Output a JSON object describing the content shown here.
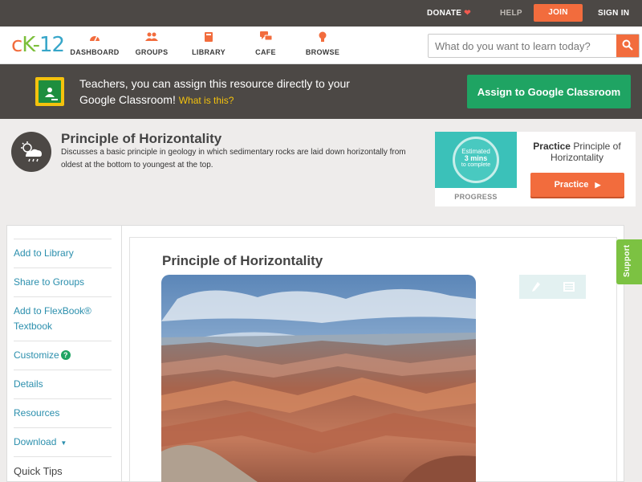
{
  "utility_bar": {
    "donate": "DONATE",
    "help": "HELP",
    "join": "JOIN",
    "sign_in": "SIGN IN"
  },
  "logo": {
    "c": "c",
    "k": "K",
    "dash": "-",
    "n": "12"
  },
  "nav": {
    "items": [
      {
        "label": "DASHBOARD",
        "icon": "dashboard-gauge-icon"
      },
      {
        "label": "GROUPS",
        "icon": "people-icon"
      },
      {
        "label": "LIBRARY",
        "icon": "book-icon"
      },
      {
        "label": "CAFE",
        "icon": "chat-bubbles-icon"
      },
      {
        "label": "BROWSE",
        "icon": "lightbulb-icon"
      }
    ]
  },
  "search": {
    "placeholder": "What do you want to learn today?",
    "value": ""
  },
  "classroom_banner": {
    "text": "Teachers, you can assign this resource directly to your Google Classroom!",
    "what_link": "What is this?",
    "button": "Assign to Google Classroom"
  },
  "concept": {
    "title": "Principle of Horizontality",
    "description": "Discusses a basic principle in geology in which sedimentary rocks are laid down horizontally from oldest at the bottom to youngest at the top.",
    "icon": "weather-cloud-icon"
  },
  "practice": {
    "estimate_top": "Estimated",
    "estimate_value": "3 mins",
    "estimate_bottom": "to complete",
    "progress_label": "PROGRESS",
    "title_bold": "Practice",
    "title_rest": "Principle of Horizontality",
    "button": "Practice"
  },
  "sidebar": {
    "items": [
      {
        "label": "Add to Library"
      },
      {
        "label": "Share to Groups"
      },
      {
        "label": "Add to FlexBook® Textbook"
      },
      {
        "label": "Customize"
      },
      {
        "label": "Details"
      },
      {
        "label": "Resources"
      },
      {
        "label": "Download"
      },
      {
        "label": "Quick Tips"
      }
    ],
    "help_glyph": "?",
    "caret_glyph": "▼"
  },
  "main": {
    "title": "Principle of Horizontality",
    "image_subject": "Grand Canyon landscape"
  },
  "support_tab": "Support",
  "colors": {
    "brand_orange": "#f26c3d",
    "brand_green": "#7bbf3a",
    "brand_blue": "#37a6c9",
    "classroom_green": "#1fa463",
    "dark_bar": "#4c4845",
    "link_blue": "#2b8fad"
  }
}
